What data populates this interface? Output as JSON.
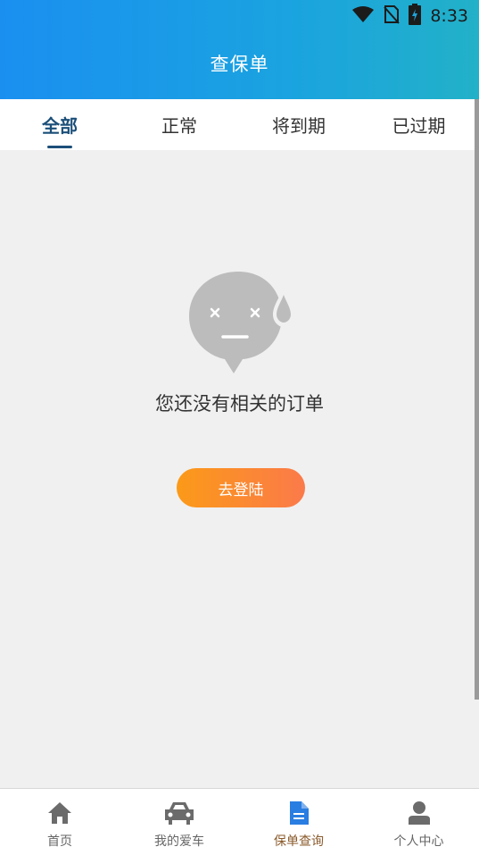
{
  "status_bar": {
    "time": "8:33"
  },
  "header": {
    "title": "查保单"
  },
  "tabs": [
    {
      "label": "全部",
      "active": true
    },
    {
      "label": "正常",
      "active": false
    },
    {
      "label": "将到期",
      "active": false
    },
    {
      "label": "已过期",
      "active": false
    }
  ],
  "empty_state": {
    "message": "您还没有相关的订单",
    "login_label": "去登陆"
  },
  "bottom_nav": [
    {
      "label": "首页",
      "icon": "home-icon"
    },
    {
      "label": "我的爱车",
      "icon": "car-icon"
    },
    {
      "label": "保单查询",
      "icon": "document-icon"
    },
    {
      "label": "个人中心",
      "icon": "person-icon"
    }
  ],
  "colors": {
    "header_start": "#1a8ff0",
    "header_end": "#22b1c8",
    "tab_active": "#1b4f79",
    "button_start": "#fb9a18",
    "button_end": "#fb7a4a",
    "nav_active": "#8a5a2b",
    "nav_active_icon": "#2a7de1"
  }
}
